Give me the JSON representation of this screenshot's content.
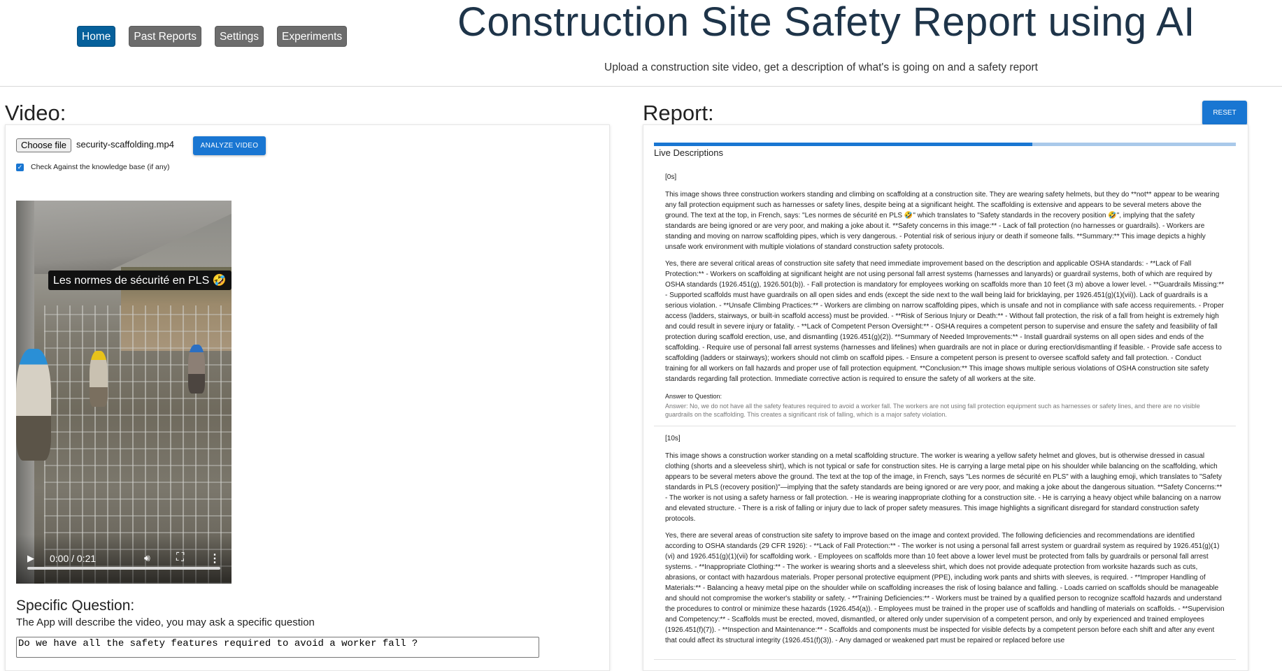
{
  "nav": {
    "items": [
      {
        "label": "Home",
        "active": true
      },
      {
        "label": "Past Reports",
        "active": false
      },
      {
        "label": "Settings",
        "active": false
      },
      {
        "label": "Experiments",
        "active": false
      }
    ]
  },
  "header": {
    "title": "Construction Site Safety Report using AI",
    "subtitle": "Upload a construction site video, get a description of what's is going on and a safety report"
  },
  "video_panel": {
    "title": "Video:",
    "choose_file_label": "Choose file",
    "file_name": "security-scaffolding.mp4",
    "analyze_label": "ANALYZE VIDEO",
    "kb_checkbox_checked": true,
    "kb_checkbox_label": "Check Against the knowledge base (if any)",
    "player": {
      "caption": "Les normes de sécurité en PLS 🤣",
      "time": "0:00 / 0:21",
      "progress": 0
    },
    "specific_question_title": "Specific Question:",
    "specific_question_hint": "The App will describe the video, you may ask a specific question",
    "question_value": "Do we have all the safety features required to avoid a worker fall ?"
  },
  "report_panel": {
    "title": "Report:",
    "reset_label": "RESET",
    "progress_fraction": 0.65,
    "live_label": "Live Descriptions",
    "entries": [
      {
        "timestamp": "[0s]",
        "description": "This image shows three construction workers standing and climbing on scaffolding at a construction site. They are wearing safety helmets, but they do **not** appear to be wearing any fall protection equipment such as harnesses or safety lines, despite being at a significant height. The scaffolding is extensive and appears to be several meters above the ground. The text at the top, in French, says: \"Les normes de sécurité en PLS 🤣\" which translates to \"Safety standards in the recovery position 🤣\", implying that the safety standards are being ignored or are very poor, and making a joke about it. **Safety concerns in this image:** - Lack of fall protection (no harnesses or guardrails). - Workers are standing and moving on narrow scaffolding pipes, which is very dangerous. - Potential risk of serious injury or death if someone falls. **Summary:** This image depicts a highly unsafe work environment with multiple violations of standard construction safety protocols.",
        "analysis": "Yes, there are several critical areas of construction site safety that need immediate improvement based on the description and applicable OSHA standards: - **Lack of Fall Protection:** - Workers on scaffolding at significant height are not using personal fall arrest systems (harnesses and lanyards) or guardrail systems, both of which are required by OSHA standards (1926.451(g), 1926.501(b)). - Fall protection is mandatory for employees working on scaffolds more than 10 feet (3 m) above a lower level. - **Guardrails Missing:** - Supported scaffolds must have guardrails on all open sides and ends (except the side next to the wall being laid for bricklaying, per 1926.451(g)(1)(vii)). Lack of guardrails is a serious violation. - **Unsafe Climbing Practices:** - Workers are climbing on narrow scaffolding pipes, which is unsafe and not in compliance with safe access requirements. - Proper access (ladders, stairways, or built-in scaffold access) must be provided. - **Risk of Serious Injury or Death:** - Without fall protection, the risk of a fall from height is extremely high and could result in severe injury or fatality. - **Lack of Competent Person Oversight:** - OSHA requires a competent person to supervise and ensure the safety and feasibility of fall protection during scaffold erection, use, and dismantling (1926.451(g)(2)). **Summary of Needed Improvements:** - Install guardrail systems on all open sides and ends of the scaffolding. - Require use of personal fall arrest systems (harnesses and lifelines) when guardrails are not in place or during erection/dismantling if feasible. - Provide safe access to scaffolding (ladders or stairways); workers should not climb on scaffold pipes. - Ensure a competent person is present to oversee scaffold safety and fall protection. - Conduct training for all workers on fall hazards and proper use of fall protection equipment. **Conclusion:** This image shows multiple serious violations of OSHA construction site safety standards regarding fall protection. Immediate corrective action is required to ensure the safety of all workers at the site.",
        "answer_label": "Answer to Question:",
        "answer": "Answer: No, we do not have all the safety features required to avoid a worker fall. The workers are not using fall protection equipment such as harnesses or safety lines, and there are no visible guardrails on the scaffolding. This creates a significant risk of falling, which is a major safety violation."
      },
      {
        "timestamp": "[10s]",
        "description": "This image shows a construction worker standing on a metal scaffolding structure. The worker is wearing a yellow safety helmet and gloves, but is otherwise dressed in casual clothing (shorts and a sleeveless shirt), which is not typical or safe for construction sites. He is carrying a large metal pipe on his shoulder while balancing on the scaffolding, which appears to be several meters above the ground. The text at the top of the image, in French, says \"Les normes de sécurité en PLS\" with a laughing emoji, which translates to \"Safety standards in PLS (recovery position)\"—implying that the safety standards are being ignored or are very poor, and making a joke about the dangerous situation. **Safety Concerns:** - The worker is not using a safety harness or fall protection. - He is wearing inappropriate clothing for a construction site. - He is carrying a heavy object while balancing on a narrow and elevated structure. - There is a risk of falling or injury due to lack of proper safety measures. This image highlights a significant disregard for standard construction safety protocols.",
        "analysis": "Yes, there are several areas of construction site safety to improve based on the image and context provided. The following deficiencies and recommendations are identified according to OSHA standards (29 CFR 1926): - **Lack of Fall Protection:** - The worker is not using a personal fall arrest system or guardrail system as required by 1926.451(g)(1)(vi) and 1926.451(g)(1)(vii) for scaffolding work. - Employees on scaffolds more than 10 feet above a lower level must be protected from falls by guardrails or personal fall arrest systems. - **Inappropriate Clothing:** - The worker is wearing shorts and a sleeveless shirt, which does not provide adequate protection from worksite hazards such as cuts, abrasions, or contact with hazardous materials. Proper personal protective equipment (PPE), including work pants and shirts with sleeves, is required. - **Improper Handling of Materials:** - Balancing a heavy metal pipe on the shoulder while on scaffolding increases the risk of losing balance and falling. - Loads carried on scaffolds should be manageable and should not compromise the worker's stability or safety. - **Training Deficiencies:** - Workers must be trained by a qualified person to recognize scaffold hazards and understand the procedures to control or minimize these hazards (1926.454(a)). - Employees must be trained in the proper use of scaffolds and handling of materials on scaffolds. - **Supervision and Competency:** - Scaffolds must be erected, moved, dismantled, or altered only under supervision of a competent person, and only by experienced and trained employees (1926.451(f)(7)). - **Inspection and Maintenance:** - Scaffolds and components must be inspected for visible defects by a competent person before each shift and after any event that could affect its structural integrity (1926.451(f)(3)). - Any damaged or weakened part must be repaired or replaced before use"
      }
    ]
  }
}
